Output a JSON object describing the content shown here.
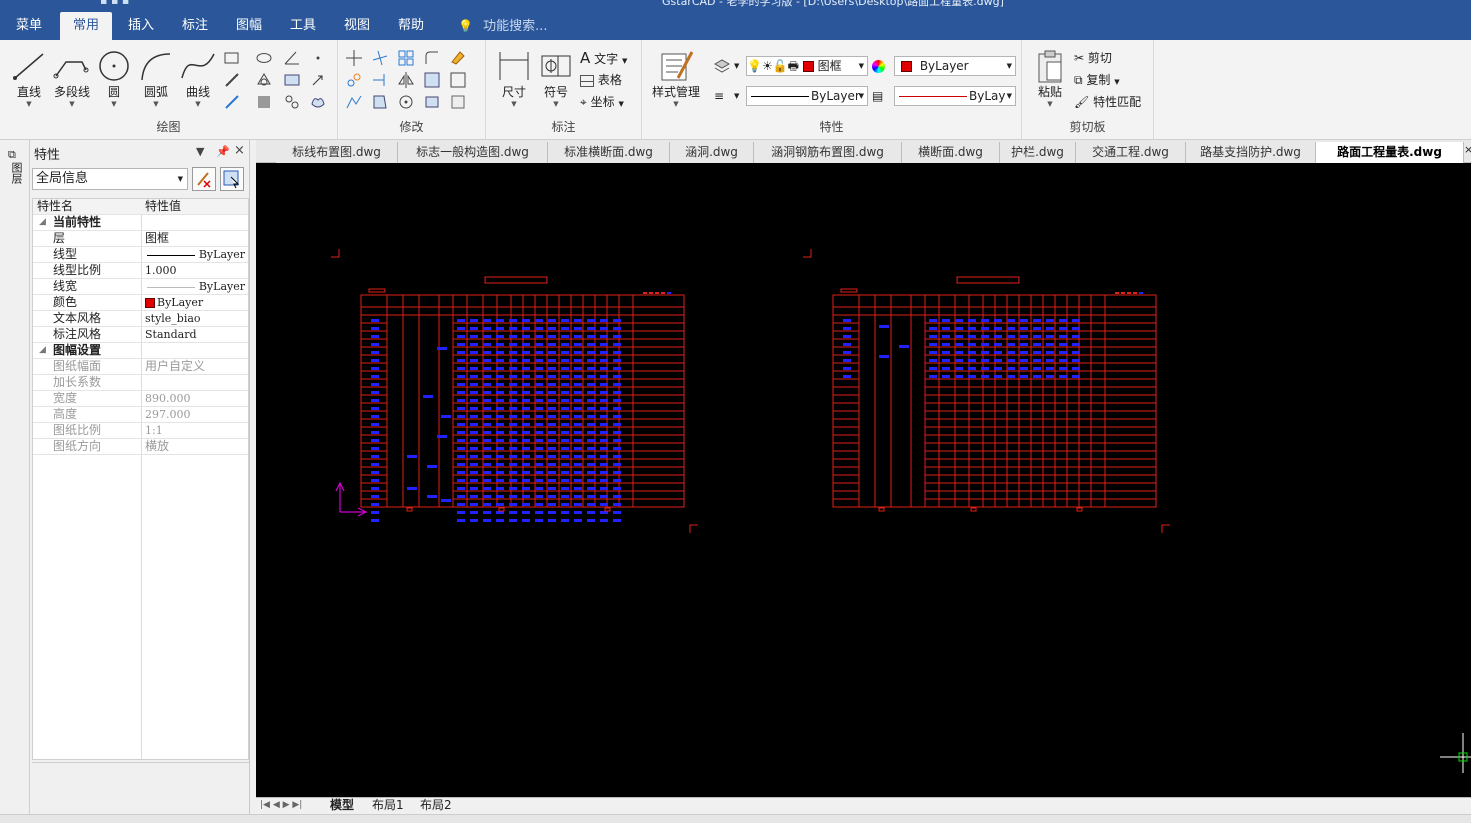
{
  "titlebar": {
    "title": "GstarCAD - 老李的学习版 - [D:\\Users\\Desktop\\路面工程量表.dwg]"
  },
  "menu": {
    "tabs": [
      "菜单",
      "常用",
      "插入",
      "标注",
      "图幅",
      "工具",
      "视图",
      "帮助"
    ],
    "active_index": 1,
    "search_placeholder": "功能搜索..."
  },
  "ribbon": {
    "draw": {
      "label": "绘图",
      "line": "直线",
      "polyline": "多段线",
      "circle": "圆",
      "arc": "圆弧",
      "curve": "曲线"
    },
    "modify": {
      "label": "修改"
    },
    "annotate": {
      "label": "标注",
      "dimension": "尺寸",
      "symbol": "符号",
      "text": "文字",
      "table": "表格",
      "coord": "坐标"
    },
    "style": {
      "label": "样式管理"
    },
    "properties": {
      "label": "特性",
      "layer_value": "图框",
      "color_value": "ByLayer",
      "linetype_value": "ByLayer",
      "lineweight_value": "ByLay"
    },
    "clipboard": {
      "label": "剪切板",
      "paste": "粘贴",
      "cut": "剪切",
      "copy": "复制",
      "match": "特性匹配"
    }
  },
  "leftstrip": {
    "label": "图层"
  },
  "properties_panel": {
    "title": "特性",
    "pin_icon": "pin-icon",
    "close": "×",
    "selector": "全局信息",
    "header_name": "特性名",
    "header_value": "特性值",
    "section_current": "当前特性",
    "rows_current": [
      {
        "name": "层",
        "value": "图框"
      },
      {
        "name": "线型",
        "value": "ByLayer"
      },
      {
        "name": "线型比例",
        "value": "1.000"
      },
      {
        "name": "线宽",
        "value": "ByLayer"
      },
      {
        "name": "颜色",
        "value": "ByLayer"
      },
      {
        "name": "文本风格",
        "value": "style_biao"
      },
      {
        "name": "标注风格",
        "value": "Standard"
      }
    ],
    "section_frame": "图幅设置",
    "rows_frame": [
      {
        "name": "图纸幅面",
        "value": "用户自定义"
      },
      {
        "name": "加长系数",
        "value": ""
      },
      {
        "name": "宽度",
        "value": "890.000"
      },
      {
        "name": "高度",
        "value": "297.000"
      },
      {
        "name": "图纸比例",
        "value": "1:1"
      },
      {
        "name": "图纸方向",
        "value": "横放"
      }
    ]
  },
  "doc_tabs": [
    "标线布置图.dwg",
    "标志一般构造图.dwg",
    "标准横断面.dwg",
    "涵洞.dwg",
    "涵洞钢筋布置图.dwg",
    "横断面.dwg",
    "护栏.dwg",
    "交通工程.dwg",
    "路基支挡防护.dwg",
    "路面工程量表.dwg"
  ],
  "doc_tabs_active": 9,
  "layout_tabs": [
    "模型",
    "布局1",
    "布局2"
  ],
  "layout_tabs_active": 0,
  "colors": {
    "ribbon_blue": "#2b579a",
    "canvas_bg": "#000000",
    "drawing_red": "#e0201a",
    "drawing_blue": "#2222ff",
    "ucs_magenta": "#d000d0"
  }
}
